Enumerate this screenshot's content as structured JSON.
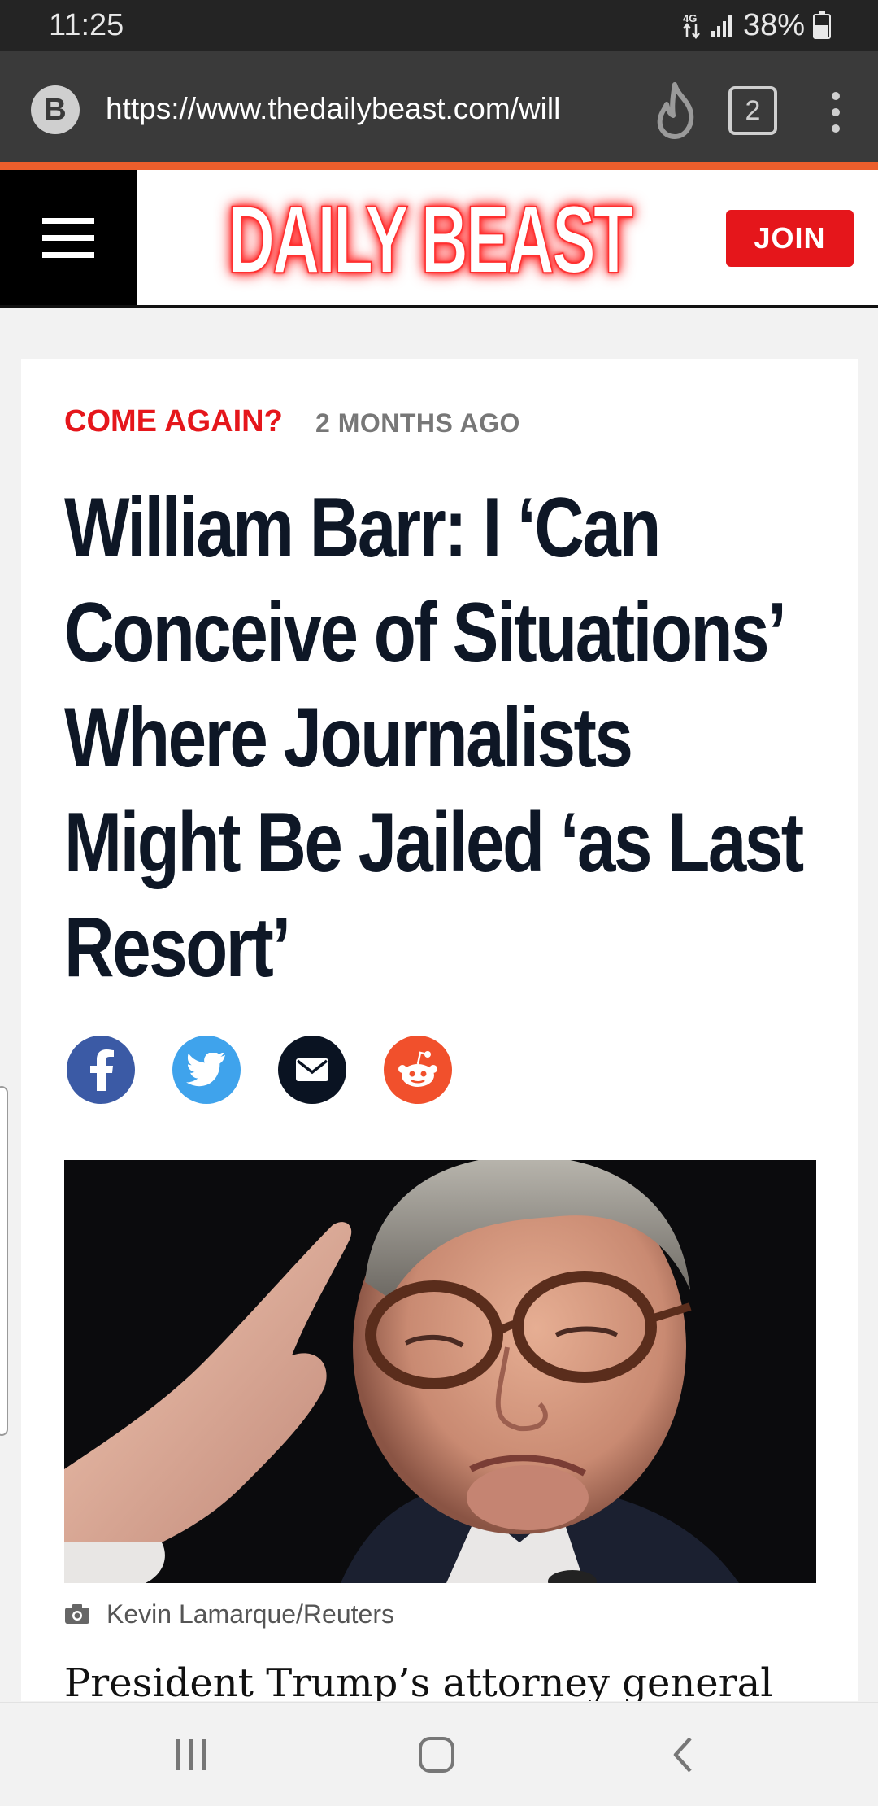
{
  "status_bar": {
    "time": "11:25",
    "battery": "38%",
    "icons": [
      "data-4g-icon",
      "signal-icon",
      "battery-icon"
    ]
  },
  "browser": {
    "site_badge": "B",
    "url": "https://www.thedailybeast.com/will",
    "tab_count": "2",
    "accent_color": "#ec5e2c"
  },
  "header": {
    "logo": "DAILY BEAST",
    "join_label": "JOIN",
    "brand_color": "#e5161b"
  },
  "article": {
    "kicker": "COME AGAIN?",
    "time_ago": "2 MONTHS AGO",
    "headline_lines": [
      "William Barr: I ‘Can",
      "Conceive of Situations’",
      "Where Journalists",
      "Might Be Jailed ‘as Last",
      "Resort’"
    ],
    "share": [
      "facebook-icon",
      "twitter-icon",
      "email-icon",
      "reddit-icon"
    ],
    "photo_credit": "Kevin Lamarque/Reuters",
    "body_first_line": "President Trump’s attorney general"
  }
}
